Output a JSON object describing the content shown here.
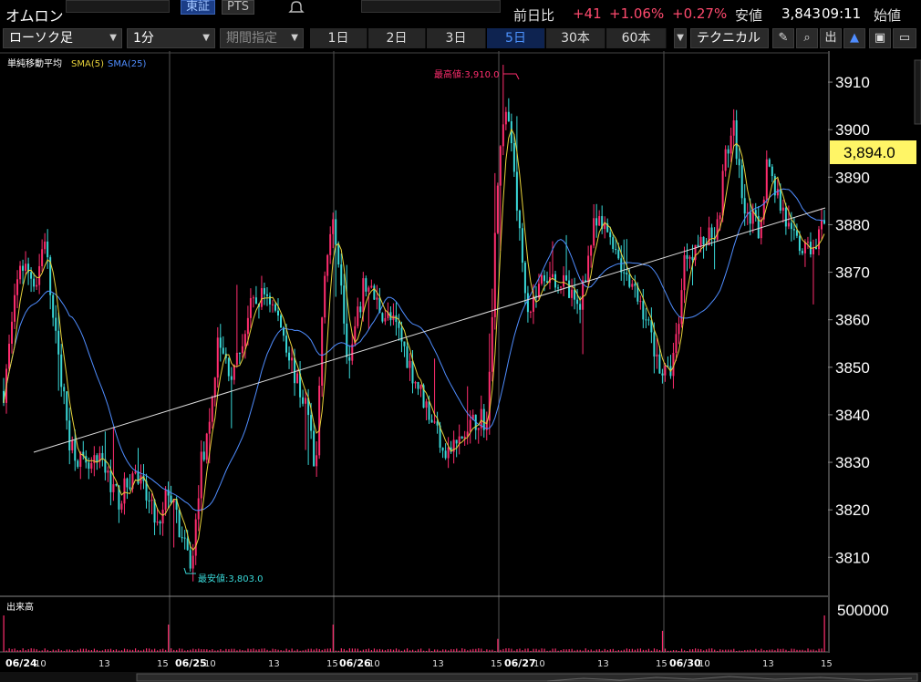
{
  "header": {
    "stock_name": "オムロン",
    "market_tabs": [
      "東証",
      "PTS"
    ],
    "prev_day_label": "前日比",
    "prev_day_change": "+41",
    "prev_day_pct": "+1.06%",
    "intraday_pct": "+0.27%",
    "low_label": "安値",
    "low_value": "3,843",
    "time": "09:11",
    "open_label": "始値"
  },
  "toolbar": {
    "chart_type": "ローソク足",
    "interval": "1分",
    "period_placeholder": "期間指定",
    "ranges": [
      "1日",
      "2日",
      "3日",
      "5日",
      "30本",
      "60本"
    ],
    "active_range": "5日",
    "technical_label": "テクニカル",
    "tools": [
      "pencil-icon",
      "zoom-icon",
      "volume-icon",
      "area-chart-icon",
      "save-icon",
      "folder-icon"
    ],
    "tool_glyphs": [
      "✎",
      "⌕",
      "出",
      "▲",
      "▣",
      "▭"
    ]
  },
  "chart_data": {
    "type": "candlestick",
    "indicator_label": "単純移動平均",
    "sma5_label": "SMA(5)",
    "sma25_label": "SMA(25)",
    "sma5_color": "#e8d23a",
    "sma25_color": "#4f8dff",
    "up_color": "#ff2d6e",
    "down_color": "#39d8d8",
    "y_ticks": [
      3810,
      3820,
      3830,
      3840,
      3850,
      3860,
      3870,
      3880,
      3890,
      3900,
      3910
    ],
    "ylim": [
      3802,
      3915
    ],
    "current_price": "3,894.0",
    "max_label": "最高値:3,910.0",
    "min_label": "最安値:3,803.0",
    "max_value": 3910,
    "min_value": 3803,
    "volume_label": "出来高",
    "volume_axis": "500000",
    "dates": [
      "06/24",
      "06/25",
      "06/26",
      "06/27",
      "06/30"
    ],
    "hour_ticks": [
      "10",
      "13",
      "15"
    ],
    "price_path": [
      [
        0,
        3845
      ],
      [
        2,
        3872
      ],
      [
        4,
        3868
      ],
      [
        5,
        3878
      ],
      [
        6,
        3860
      ],
      [
        8,
        3835
      ],
      [
        10,
        3828
      ],
      [
        12,
        3830
      ],
      [
        14,
        3822
      ],
      [
        16,
        3828
      ],
      [
        18,
        3820
      ],
      [
        19,
        3815
      ],
      [
        20,
        3825
      ],
      [
        22,
        3812
      ],
      [
        23,
        3808
      ],
      [
        24,
        3830
      ],
      [
        25,
        3835
      ],
      [
        26,
        3855
      ],
      [
        28,
        3848
      ],
      [
        30,
        3862
      ],
      [
        32,
        3866
      ],
      [
        34,
        3858
      ],
      [
        36,
        3845
      ],
      [
        37,
        3842
      ],
      [
        38,
        3825
      ],
      [
        39,
        3870
      ],
      [
        40,
        3880
      ],
      [
        41,
        3872
      ],
      [
        42,
        3850
      ],
      [
        44,
        3868
      ],
      [
        46,
        3862
      ],
      [
        48,
        3858
      ],
      [
        50,
        3848
      ],
      [
        52,
        3840
      ],
      [
        54,
        3832
      ],
      [
        56,
        3835
      ],
      [
        58,
        3840
      ],
      [
        59,
        3838
      ],
      [
        60,
        3885
      ],
      [
        61,
        3905
      ],
      [
        62,
        3896
      ],
      [
        63,
        3875
      ],
      [
        64,
        3862
      ],
      [
        66,
        3870
      ],
      [
        68,
        3868
      ],
      [
        70,
        3862
      ],
      [
        72,
        3880
      ],
      [
        74,
        3878
      ],
      [
        76,
        3868
      ],
      [
        78,
        3862
      ],
      [
        80,
        3850
      ],
      [
        81,
        3848
      ],
      [
        82,
        3856
      ],
      [
        83,
        3874
      ],
      [
        85,
        3876
      ],
      [
        87,
        3880
      ],
      [
        88,
        3895
      ],
      [
        89,
        3900
      ],
      [
        90,
        3886
      ],
      [
        92,
        3878
      ],
      [
        93,
        3893
      ],
      [
        94,
        3888
      ],
      [
        96,
        3877
      ],
      [
        98,
        3874
      ],
      [
        100,
        3880
      ]
    ]
  }
}
